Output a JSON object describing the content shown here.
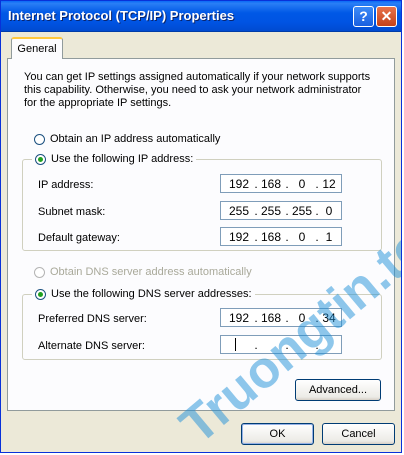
{
  "window": {
    "title": "Internet Protocol (TCP/IP) Properties",
    "help_glyph": "?",
    "close_glyph": "✕"
  },
  "tabs": [
    {
      "label": "General"
    }
  ],
  "description": "You can get IP settings assigned automatically if your network supports this capability. Otherwise, you need to ask your network administrator for the appropriate IP settings.",
  "ip": {
    "auto_label": "Obtain an IP address automatically",
    "manual_label": "Use the following IP address:",
    "fields": [
      {
        "label": "IP address:",
        "octets": [
          "192",
          "168",
          "0",
          "12"
        ]
      },
      {
        "label": "Subnet mask:",
        "octets": [
          "255",
          "255",
          "255",
          "0"
        ]
      },
      {
        "label": "Default gateway:",
        "octets": [
          "192",
          "168",
          "0",
          "1"
        ]
      }
    ]
  },
  "dns": {
    "auto_label": "Obtain DNS server address automatically",
    "manual_label": "Use the following DNS server addresses:",
    "fields": [
      {
        "label": "Preferred DNS server:",
        "octets": [
          "192",
          "168",
          "0",
          "34"
        ]
      },
      {
        "label": "Alternate DNS server:",
        "octets": [
          "",
          "",
          "",
          ""
        ]
      }
    ]
  },
  "buttons": {
    "advanced": "Advanced...",
    "ok": "OK",
    "cancel": "Cancel"
  },
  "watermark": "Truongtin.top"
}
